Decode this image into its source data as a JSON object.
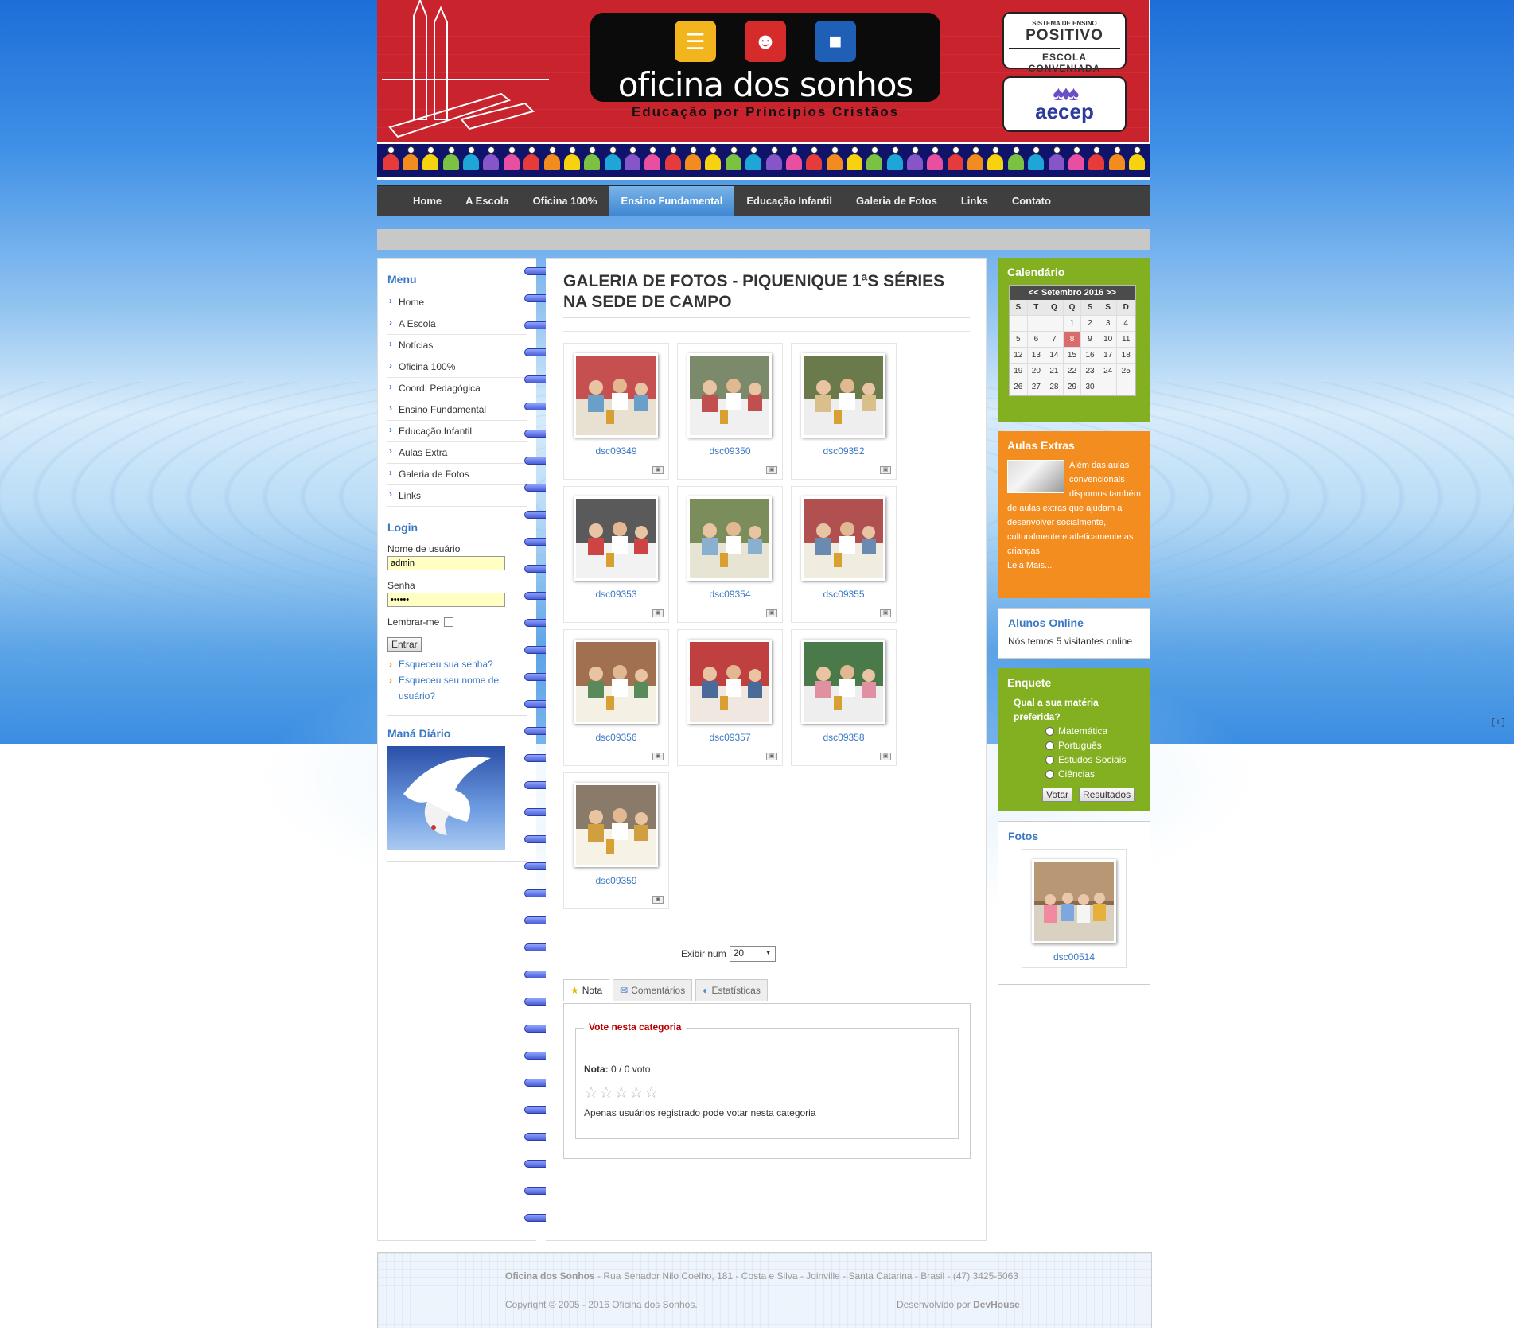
{
  "header": {
    "logo_title": "oficina dos sonhos",
    "logo_subtitle": "Educação por Princípios Cristãos",
    "positivo_small": "SISTEMA DE ENSINO",
    "positivo_big": "POSITIVO",
    "positivo_strip": "ESCOLA CONVENIADA",
    "aecep": "aecep"
  },
  "nav": {
    "items": [
      "Home",
      "A Escola",
      "Oficina 100%",
      "Ensino Fundamental",
      "Educação Infantil",
      "Galeria de Fotos",
      "Links",
      "Contato"
    ],
    "active": "Ensino Fundamental"
  },
  "left": {
    "menu_title": "Menu",
    "menu_items": [
      "Home",
      "A Escola",
      "Notícias",
      "Oficina 100%",
      "Coord. Pedagógica",
      "Ensino Fundamental",
      "Educação Infantil",
      "Aulas Extra",
      "Galeria de Fotos",
      "Links"
    ],
    "login_title": "Login",
    "username_label": "Nome de usuário",
    "username_value": "admin",
    "password_label": "Senha",
    "password_value": "••••••",
    "remember_label": "Lembrar-me",
    "submit_label": "Entrar",
    "forgot_password": "Esqueceu sua senha?",
    "forgot_username": "Esqueceu seu nome de usuário?",
    "mana_title": "Maná Diário"
  },
  "content": {
    "title": "GALERIA DE FOTOS - PIQUENIQUE 1ªS SÉRIES NA SEDE DE CAMPO",
    "photos": [
      "dsc09349",
      "dsc09350",
      "dsc09352",
      "dsc09353",
      "dsc09354",
      "dsc09355",
      "dsc09356",
      "dsc09357",
      "dsc09358",
      "dsc09359"
    ],
    "display_label": "Exibir num",
    "display_value": "20",
    "tabs": [
      "Nota",
      "Comentários",
      "Estatísticas"
    ],
    "vote_legend": "Vote nesta categoria",
    "rating_label": "Nota:",
    "rating_value": "0 / 0 voto",
    "rating_note": "Apenas usuários registrado pode votar nesta categoria"
  },
  "right": {
    "calendar_title": "Calendário",
    "calendar_month": "<< Setembro 2016 >>",
    "calendar_dow": [
      "S",
      "T",
      "Q",
      "Q",
      "S",
      "S",
      "D"
    ],
    "calendar_days": [
      "",
      "",
      "",
      "1",
      "2",
      "3",
      "4",
      "5",
      "6",
      "7",
      "8",
      "9",
      "10",
      "11",
      "12",
      "13",
      "14",
      "15",
      "16",
      "17",
      "18",
      "19",
      "20",
      "21",
      "22",
      "23",
      "24",
      "25",
      "26",
      "27",
      "28",
      "29",
      "30",
      "",
      ""
    ],
    "calendar_today": "8",
    "aulas_title": "Aulas Extras",
    "aulas_text": "Além das aulas convencionais dispomos também de aulas extras que ajudam a desenvolver socialmente, culturalmente e atleticamente as crianças.",
    "aulas_more": "Leia Mais...",
    "online_title": "Alunos Online",
    "online_text": "Nós temos 5 visitantes online",
    "poll_title": "Enquete",
    "poll_question": "Qual a sua matéria preferida?",
    "poll_options": [
      "Matemática",
      "Português",
      "Estudos Sociais",
      "Ciências"
    ],
    "poll_vote": "Votar",
    "poll_results": "Resultados",
    "fotos_title": "Fotos",
    "fotos_name": "dsc00514"
  },
  "footer": {
    "school": "Oficina dos Sonhos",
    "address": " - Rua Senador Nilo Coelho, 181 - Costa e Silva - Joinville - Santa Catarina - Brasil - (47) 3425-5063",
    "copyright": "Copyright © 2005 - 2016 Oficina dos Sonhos.",
    "dev_prefix": "Desenvolvido por ",
    "dev_name": "DevHouse"
  },
  "corner_toggle": "[+]",
  "colors": {
    "header_red": "#c9232e",
    "nav_dark": "#3f3f3f",
    "nav_active": "#3f86d2",
    "link_blue": "#3b78c4",
    "green": "#83b020",
    "orange": "#f38d1f"
  }
}
